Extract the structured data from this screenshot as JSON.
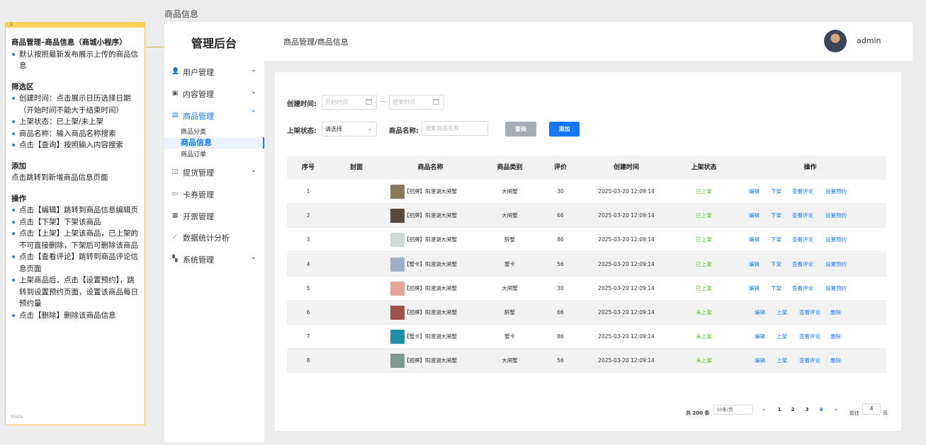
{
  "page_label": "商品信息",
  "note": {
    "number": "1",
    "footer": "Koala",
    "lines": [
      {
        "type": "h",
        "text": "商品管理–商品信息（商城小程序）"
      },
      {
        "type": "li",
        "text": "默认按照最新发布展示上传的商品信息"
      },
      {
        "type": "gap"
      },
      {
        "type": "h",
        "text": "筛选区"
      },
      {
        "type": "li",
        "text": "创建时间：点击展示日历选择日期（开始时间不能大于结束时间）"
      },
      {
        "type": "li",
        "text": "上架状态：已上架/未上架"
      },
      {
        "type": "li",
        "text": "商品名称：输入商品名称搜索"
      },
      {
        "type": "li",
        "text": "点击【查询】按照输入内容搜索"
      },
      {
        "type": "gap"
      },
      {
        "type": "h",
        "text": "添加"
      },
      {
        "type": "p",
        "text": "点击跳转到新增商品信息页面"
      },
      {
        "type": "gap"
      },
      {
        "type": "h",
        "text": "操作"
      },
      {
        "type": "li",
        "text": "点击【编辑】跳转到商品信息编辑页"
      },
      {
        "type": "li",
        "text": "点击【下架】下架该商品"
      },
      {
        "type": "li",
        "text": "点击【上架】上架该商品，已上架的不可直接删除，下架后可删除该商品"
      },
      {
        "type": "li",
        "text": "点击【查看评论】跳转到商品评论信息页面"
      },
      {
        "type": "li",
        "text": "上架商品后，点击【设置预约】，跳转到设置预约页面，设置该商品每日预约量"
      },
      {
        "type": "li",
        "text": "点击【删除】删除该商品信息"
      }
    ]
  },
  "header": {
    "title": "管理后台",
    "breadcrumb": "商品管理/商品信息",
    "username": "admin"
  },
  "sidebar": {
    "items": [
      {
        "label": "用户管理",
        "icon": "user-icon",
        "glyph": "👤",
        "arrow": "⌄"
      },
      {
        "label": "内容管理",
        "icon": "monitor-icon",
        "glyph": "▣",
        "arrow": "⌄"
      },
      {
        "label": "商品管理",
        "icon": "shop-icon",
        "glyph": "▤",
        "arrow": "⌃",
        "active": true
      },
      {
        "label": "提货管理",
        "icon": "pickup-icon",
        "glyph": "◫",
        "arrow": "⌄"
      },
      {
        "label": "卡券管理",
        "icon": "coupon-icon",
        "glyph": "▭",
        "arrow": ""
      },
      {
        "label": "开票管理",
        "icon": "invoice-icon",
        "glyph": "▦",
        "arrow": ""
      },
      {
        "label": "数据统计分析",
        "icon": "chart-icon",
        "glyph": "⟋",
        "arrow": ""
      },
      {
        "label": "系统管理",
        "icon": "grid-icon",
        "glyph": "▚",
        "arrow": "⌄"
      }
    ],
    "sub_items": [
      "商品分类",
      "商品信息",
      "商品订单"
    ]
  },
  "filters": {
    "created_label": "创建时间:",
    "start_placeholder": "开始时间",
    "end_placeholder": "结束时间",
    "dash": "—",
    "status_label": "上架状态:",
    "status_value": "请选择",
    "name_label": "商品名称:",
    "name_placeholder": "搜索商品名称",
    "query": "查询",
    "add": "添加"
  },
  "table": {
    "headers": [
      "序号",
      "封面",
      "商品名称",
      "商品类别",
      "评价",
      "创建时间",
      "上架状态",
      "操作"
    ],
    "rows": [
      {
        "no": "1",
        "name": "【招牌】阳澄湖大闸蟹",
        "category": "大闸蟹",
        "rating": "30",
        "time": "2025-03-20 12:09:14",
        "status": "已上架",
        "ops": [
          "编辑",
          "下架",
          "查看评论",
          "设置预约"
        ],
        "thumb": "#8a7a5c"
      },
      {
        "no": "2",
        "name": "【招牌】阳澄湖大闸蟹",
        "category": "大闸蟹",
        "rating": "66",
        "time": "2025-03-20 12:09:14",
        "status": "已上架",
        "ops": [
          "编辑",
          "下架",
          "查看评论",
          "设置预约"
        ],
        "thumb": "#5a4a3e"
      },
      {
        "no": "3",
        "name": "【招牌】阳澄湖大闸蟹",
        "category": "醉蟹",
        "rating": "86",
        "time": "2025-03-20 12:09:14",
        "status": "已上架",
        "ops": [
          "编辑",
          "下架",
          "查看评论",
          "设置预约"
        ],
        "thumb": "#cfd8d4"
      },
      {
        "no": "4",
        "name": "【蟹卡】阳澄湖大闸蟹",
        "category": "蟹卡",
        "rating": "56",
        "time": "2025-03-20 12:09:14",
        "status": "已上架",
        "ops": [
          "编辑",
          "下架",
          "查看评论",
          "设置预约"
        ],
        "thumb": "#9fb0c8"
      },
      {
        "no": "5",
        "name": "【招牌】阳澄湖大闸蟹",
        "category": "大闸蟹",
        "rating": "30",
        "time": "2025-03-20 12:09:14",
        "status": "已上架",
        "ops": [
          "编辑",
          "下架",
          "查看评论",
          "设置预约"
        ],
        "thumb": "#e6a39a"
      },
      {
        "no": "6",
        "name": "【招牌】阳澄湖大闸蟹",
        "category": "醉蟹",
        "rating": "66",
        "time": "2025-03-20 12:09:14",
        "status": "未上架",
        "ops": [
          "编辑",
          "上架",
          "查看评论",
          "删除"
        ],
        "thumb": "#a0524a"
      },
      {
        "no": "7",
        "name": "【蟹卡】阳澄湖大闸蟹",
        "category": "蟹卡",
        "rating": "86",
        "time": "2025-03-20 12:09:14",
        "status": "未上架",
        "ops": [
          "编辑",
          "上架",
          "查看评论",
          "删除"
        ],
        "thumb": "#1f8fa5"
      },
      {
        "no": "8",
        "name": "【招牌】阳澄湖大闸蟹",
        "category": "大闸蟹",
        "rating": "56",
        "time": "2025-03-20 12:09:14",
        "status": "未上架",
        "ops": [
          "编辑",
          "上架",
          "查看评论",
          "删除"
        ],
        "thumb": "#7e9a8e"
      }
    ]
  },
  "pagination": {
    "total": "共 200 条",
    "page_size": "10条/页",
    "prev": "‹",
    "next": "›",
    "pages": [
      "1",
      "2",
      "3",
      "4"
    ],
    "current": "4",
    "goto_label": "前往",
    "goto_value": "4",
    "page_unit": "页"
  }
}
